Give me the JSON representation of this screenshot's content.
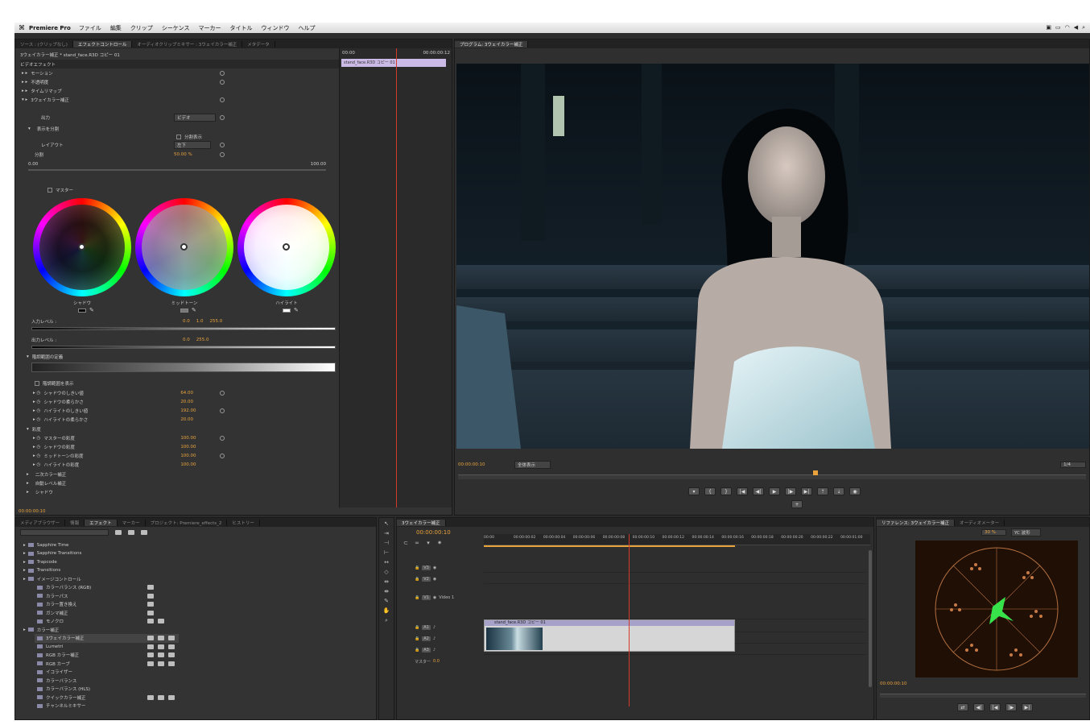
{
  "menubar": {
    "app_name": "Premiere Pro",
    "items": [
      "ファイル",
      "編集",
      "クリップ",
      "シーケンス",
      "マーカー",
      "タイトル",
      "ウィンドウ",
      "ヘルプ"
    ]
  },
  "effect_controls": {
    "tabs": [
      "ソース : (クリップなし)",
      "エフェクトコントロール",
      "オーディオクリップミキサー : 3ウェイカラー補正",
      "メタデータ"
    ],
    "header": "3ウェイカラー補正 * stand_face.R3D コピー 01",
    "section": "ビデオエフェクト",
    "effects": [
      "モーション",
      "不透明度",
      "タイムリマップ",
      "3ウェイカラー補正"
    ],
    "output_label": "出力",
    "output_value": "ビデオ",
    "split_label": "表示を分割",
    "show_split": "分割表示",
    "layout_label": "レイアウト",
    "layout_value": "左下",
    "split_pct_label": "分割",
    "split_pct_value": "50.00 %",
    "range_min": "0.00",
    "range_max": "100.00",
    "master_label": "マスター",
    "wheels": [
      "シャドウ",
      "ミッドトーン",
      "ハイライト"
    ],
    "input_levels_label": "入力レベル :",
    "input_levels": [
      "0.0",
      "1.0",
      "255.0"
    ],
    "output_levels_label": "出力レベル :",
    "output_levels": [
      "0.0",
      "255.0"
    ],
    "tonal_label": "階調範囲の定義",
    "tonal_show": "階調範囲を表示",
    "params": [
      {
        "label": "シャドウのしきい値",
        "value": "64.00"
      },
      {
        "label": "シャドウの柔らかさ",
        "value": "20.00"
      },
      {
        "label": "ハイライトのしきい値",
        "value": "192.00"
      },
      {
        "label": "ハイライトの柔らかさ",
        "value": "20.00"
      }
    ],
    "saturation_label": "彩度",
    "saturation": [
      {
        "label": "マスターの彩度",
        "value": "100.00"
      },
      {
        "label": "シャドウの彩度",
        "value": "100.00"
      },
      {
        "label": "ミッドトーンの彩度",
        "value": "100.00"
      },
      {
        "label": "ハイライトの彩度",
        "value": "100.00"
      }
    ],
    "extra": [
      "二次カラー補正",
      "自動レベル補正",
      "シャドウ"
    ],
    "timecode": "00:00:00:10",
    "mini_time_start": "00:00",
    "mini_time_end": "00:00:00:12",
    "clip_label": "stand_face.R3D コピー 01"
  },
  "program": {
    "title": "プログラム: 3ウェイカラー補正",
    "timecode": "00:00:00:10",
    "fit": "全体表示",
    "quality": "1/4"
  },
  "project": {
    "tabs": [
      "メディアブラウザー",
      "情報",
      "エフェクト",
      "マーカー",
      "プロジェクト: Premiere_effects_2",
      "ヒストリー"
    ],
    "items": [
      {
        "label": "Sapphire Time",
        "level": 0,
        "kind": "folder",
        "badges": 0
      },
      {
        "label": "Sapphire Transitions",
        "level": 0,
        "kind": "folder",
        "badges": 0
      },
      {
        "label": "Trapcode",
        "level": 0,
        "kind": "folder",
        "badges": 0
      },
      {
        "label": "Transitions",
        "level": 0,
        "kind": "folder",
        "badges": 0
      },
      {
        "label": "イメージコントロール",
        "level": 0,
        "kind": "folder",
        "badges": 0
      },
      {
        "label": "カラーバランス (RGB)",
        "level": 1,
        "kind": "fx",
        "badges": 1
      },
      {
        "label": "カラーパス",
        "level": 1,
        "kind": "fx",
        "badges": 1
      },
      {
        "label": "カラー置き換え",
        "level": 1,
        "kind": "fx",
        "badges": 1
      },
      {
        "label": "ガンマ補正",
        "level": 1,
        "kind": "fx",
        "badges": 1
      },
      {
        "label": "モノクロ",
        "level": 1,
        "kind": "fx",
        "badges": 2
      },
      {
        "label": "カラー補正",
        "level": 0,
        "kind": "folder",
        "badges": 0
      },
      {
        "label": "3ウェイカラー補正",
        "level": 1,
        "kind": "fx",
        "badges": 3
      },
      {
        "label": "Lumetri",
        "level": 1,
        "kind": "fx",
        "badges": 3
      },
      {
        "label": "RGB カラー補正",
        "level": 1,
        "kind": "fx",
        "badges": 3
      },
      {
        "label": "RGB カーブ",
        "level": 1,
        "kind": "fx",
        "badges": 3
      },
      {
        "label": "イコライザー",
        "level": 1,
        "kind": "fx",
        "badges": 0
      },
      {
        "label": "カラーバランス",
        "level": 1,
        "kind": "fx",
        "badges": 0
      },
      {
        "label": "カラーバランス (HLS)",
        "level": 1,
        "kind": "fx",
        "badges": 0
      },
      {
        "label": "クイックカラー補正",
        "level": 1,
        "kind": "fx",
        "badges": 3
      },
      {
        "label": "チャンネルミキサー",
        "level": 1,
        "kind": "fx",
        "badges": 0
      }
    ]
  },
  "timeline": {
    "tab": "3ウェイカラー補正",
    "timecode": "00:00:00:10",
    "ruler": [
      "00:00",
      "00:00:00:02",
      "00:00:00:04",
      "00:00:00:06",
      "00:00:00:08",
      "00:00:00:10",
      "00:00:00:12",
      "00:00:00:14",
      "00:00:00:16",
      "00:00:00:18",
      "00:00:00:20",
      "00:00:00:22",
      "00:00:01:00"
    ],
    "tracks": [
      "V3",
      "V2",
      "V1",
      "A1",
      "A2",
      "A3"
    ],
    "video_track_name": "Video 1",
    "master_label": "マスター",
    "master_value": "0.0",
    "clip_label": "stand_face.R3D コピー 01"
  },
  "scopes": {
    "tabs": [
      "リファレンス: 3ウェイカラー補正",
      "オーディオメーター"
    ],
    "quality": "30 %",
    "mode": "YC 波形",
    "timecode": "00:00:00:10"
  },
  "colors": {
    "accent": "#e8a33d",
    "playhead": "#d23a2a",
    "clip": "#cbb9e6"
  }
}
